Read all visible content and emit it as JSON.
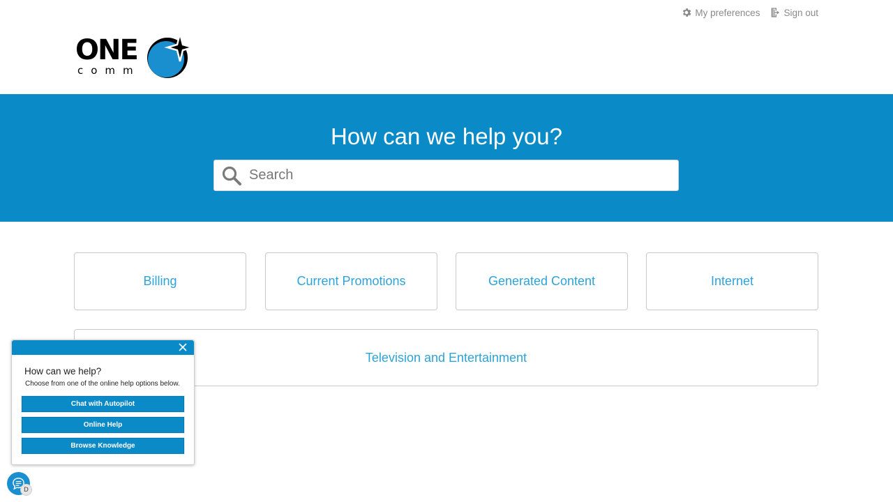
{
  "header": {
    "preferences_label": "My preferences",
    "signout_label": "Sign out",
    "logo_top": "ONE",
    "logo_bottom": "comm"
  },
  "hero": {
    "title": "How can we help you?",
    "search_placeholder": "Search"
  },
  "categories": [
    {
      "label": "Billing"
    },
    {
      "label": "Current Promotions"
    },
    {
      "label": "Generated Content"
    },
    {
      "label": "Internet"
    },
    {
      "label": "Television and Entertainment"
    }
  ],
  "help_widget": {
    "title": "How can we help?",
    "subtitle": "Choose from one of the online help options below.",
    "buttons": [
      {
        "label": "Chat with Autopilot"
      },
      {
        "label": "Online Help"
      },
      {
        "label": "Browse Knowledge"
      }
    ],
    "badge": "D"
  },
  "colors": {
    "brand_blue": "#0b8ac8",
    "link_blue": "#2ea3d8",
    "muted_text": "#8a8a8a"
  },
  "icons": {
    "preferences": "gear-icon",
    "signout": "sign-out-icon",
    "search": "search-icon",
    "close": "close-icon",
    "chat": "chat-bubble-icon"
  }
}
